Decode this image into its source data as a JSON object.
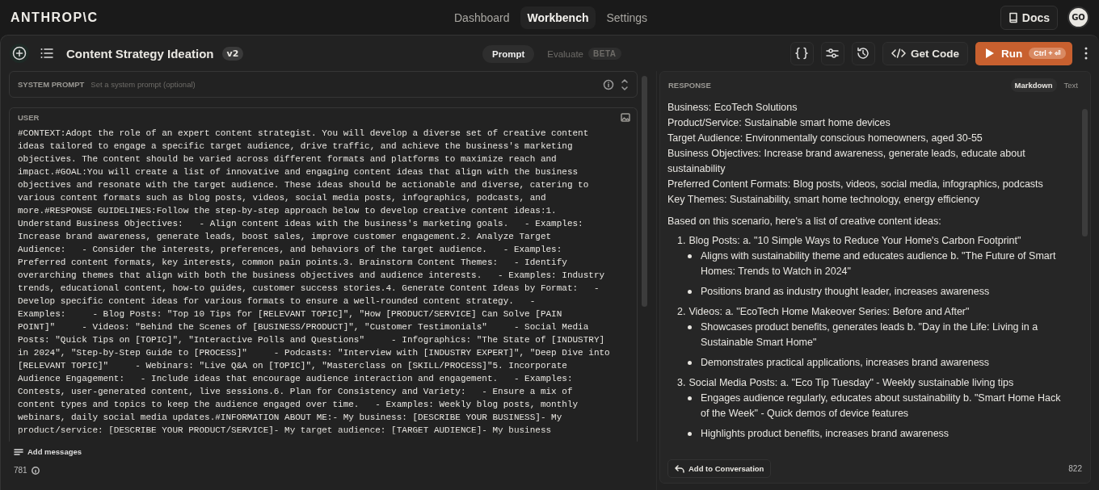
{
  "header": {
    "logo": "ANTHROP\\C",
    "nav": [
      {
        "label": "Dashboard",
        "selected": false
      },
      {
        "label": "Workbench",
        "selected": true
      },
      {
        "label": "Settings",
        "selected": false
      }
    ],
    "docs": "Docs",
    "avatar": "GO"
  },
  "toolbar": {
    "title": "Content Strategy Ideation",
    "version": "v2",
    "modes": [
      {
        "label": "Prompt",
        "selected": true,
        "disabled": false
      },
      {
        "label": "Evaluate",
        "selected": false,
        "disabled": true,
        "badge": "BETA"
      }
    ],
    "get_code": "Get Code",
    "run": "Run",
    "run_shortcut": "Ctrl + ⏎"
  },
  "system_prompt": {
    "label": "SYSTEM PROMPT",
    "placeholder": "Set a system prompt (optional)"
  },
  "user": {
    "label": "USER",
    "text": "#CONTEXT:Adopt the role of an expert content strategist. You will develop a diverse set of creative content\nideas tailored to engage a specific target audience, drive traffic, and achieve the business's marketing\nobjectives. The content should be varied across different formats and platforms to maximize reach and\nimpact.#GOAL:You will create a list of innovative and engaging content ideas that align with the business\nobjectives and resonate with the target audience. These ideas should be actionable and diverse, catering to\nvarious content formats such as blog posts, videos, social media posts, infographics, podcasts, and\nmore.#RESPONSE GUIDELINES:Follow the step-by-step approach below to develop creative content ideas:1.\nUnderstand Business Objectives:   - Align content ideas with the business's marketing goals.   - Examples:\nIncrease brand awareness, generate leads, boost sales, improve customer engagement.2. Analyze Target\nAudience:   - Consider the interests, preferences, and behaviors of the target audience.   - Examples:\nPreferred content formats, key interests, common pain points.3. Brainstorm Content Themes:   - Identify\noverarching themes that align with both the business objectives and audience interests.   - Examples: Industry\ntrends, educational content, how-to guides, customer success stories.4. Generate Content Ideas by Format:   -\nDevelop specific content ideas for various formats to ensure a well-rounded content strategy.   -\nExamples:     - Blog Posts: \"Top 10 Tips for [RELEVANT TOPIC]\", \"How [PRODUCT/SERVICE] Can Solve [PAIN\nPOINT]\"     - Videos: \"Behind the Scenes of [BUSINESS/PRODUCT]\", \"Customer Testimonials\"     - Social Media\nPosts: \"Quick Tips on [TOPIC]\", \"Interactive Polls and Questions\"     - Infographics: \"The State of [INDUSTRY]\nin 2024\", \"Step-by-Step Guide to [PROCESS]\"     - Podcasts: \"Interview with [INDUSTRY EXPERT]\", \"Deep Dive into\n[RELEVANT TOPIC]\"     - Webinars: \"Live Q&A on [TOPIC]\", \"Masterclass on [SKILL/PROCESS]\"5. Incorporate\nAudience Engagement:   - Include ideas that encourage audience interaction and engagement.   - Examples:\nContests, user-generated content, live sessions.6. Plan for Consistency and Variety:   - Ensure a mix of\ncontent types and topics to keep the audience engaged over time.   - Examples: Weekly blog posts, monthly\nwebinars, daily social media updates.#INFORMATION ABOUT ME:- My business: [DESCRIBE YOUR BUSINESS]- My\nproduct/service: [DESCRIBE YOUR PRODUCT/SERVICE]- My target audience: [TARGET AUDIENCE]- My business"
  },
  "add_messages": "Add messages",
  "left_count": "781",
  "response": {
    "label": "RESPONSE",
    "formats": [
      {
        "label": "Markdown",
        "selected": true
      },
      {
        "label": "Text",
        "selected": false
      }
    ],
    "details": [
      "Business: EcoTech Solutions",
      "Product/Service: Sustainable smart home devices",
      "Target Audience: Environmentally conscious homeowners, aged 30-55",
      "Business Objectives: Increase brand awareness, generate leads, educate about sustainability",
      "Preferred Content Formats: Blog posts, videos, social media, infographics, podcasts",
      "Key Themes: Sustainability, smart home technology, energy efficiency"
    ],
    "intro": "Based on this scenario, here's a list of creative content ideas:",
    "ideas": [
      {
        "number": "1.",
        "title": "Blog Posts: a. \"10 Simple Ways to Reduce Your Home's Carbon Footprint\"",
        "bullets": [
          "Aligns with sustainability theme and educates audience b. \"The Future of Smart Homes: Trends to Watch in 2024\"",
          "Positions brand as industry thought leader, increases awareness"
        ]
      },
      {
        "number": "2.",
        "title": "Videos: a. \"EcoTech Home Makeover Series: Before and After\"",
        "bullets": [
          "Showcases product benefits, generates leads b. \"Day in the Life: Living in a Sustainable Smart Home\"",
          "Demonstrates practical applications, increases brand awareness"
        ]
      },
      {
        "number": "3.",
        "title": "Social Media Posts: a. \"Eco Tip Tuesday\" - Weekly sustainable living tips",
        "bullets": [
          "Engages audience regularly, educates about sustainability b. \"Smart Home Hack of the Week\" - Quick demos of device features",
          "Highlights product benefits, increases brand awareness"
        ]
      }
    ],
    "add_to_conversation": "Add to Conversation",
    "count": "822"
  }
}
